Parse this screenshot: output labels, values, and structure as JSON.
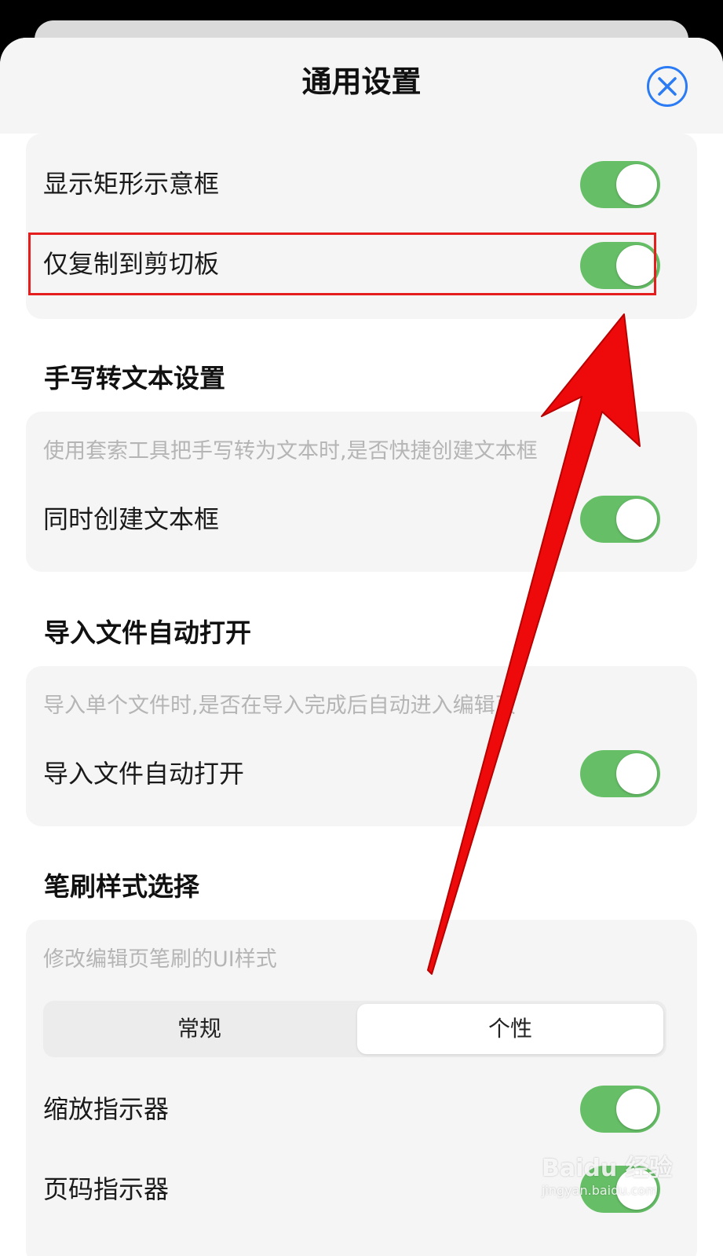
{
  "header": {
    "title": "通用设置"
  },
  "top_card": {
    "rows": [
      {
        "label": "显示矩形示意框",
        "toggle_on": true
      },
      {
        "label": "仅复制到剪切板",
        "toggle_on": true
      }
    ]
  },
  "handwriting": {
    "section_title": "手写转文本设置",
    "description": "使用套索工具把手写转为文本时,是否快捷创建文本框",
    "row_label": "同时创建文本框",
    "toggle_on": true
  },
  "import": {
    "section_title": "导入文件自动打开",
    "description": "导入单个文件时,是否在导入完成后自动进入编辑页",
    "row_label": "导入文件自动打开",
    "toggle_on": true
  },
  "brush": {
    "section_title": "笔刷样式选择",
    "description": "修改编辑页笔刷的UI样式",
    "segments": [
      "常规",
      "个性"
    ],
    "selected": "个性",
    "rows": [
      {
        "label": "缩放指示器",
        "toggle_on": true
      },
      {
        "label": "页码指示器",
        "toggle_on": true
      }
    ]
  },
  "watermark": {
    "text": "Baidu 经验",
    "sub": "jingyan.baidu.com"
  },
  "colors": {
    "toggle_on": "#66bf67",
    "close_blue": "#2a7bf4",
    "highlight_red": "#e51d1d",
    "arrow_red": "#ee0a0a"
  }
}
